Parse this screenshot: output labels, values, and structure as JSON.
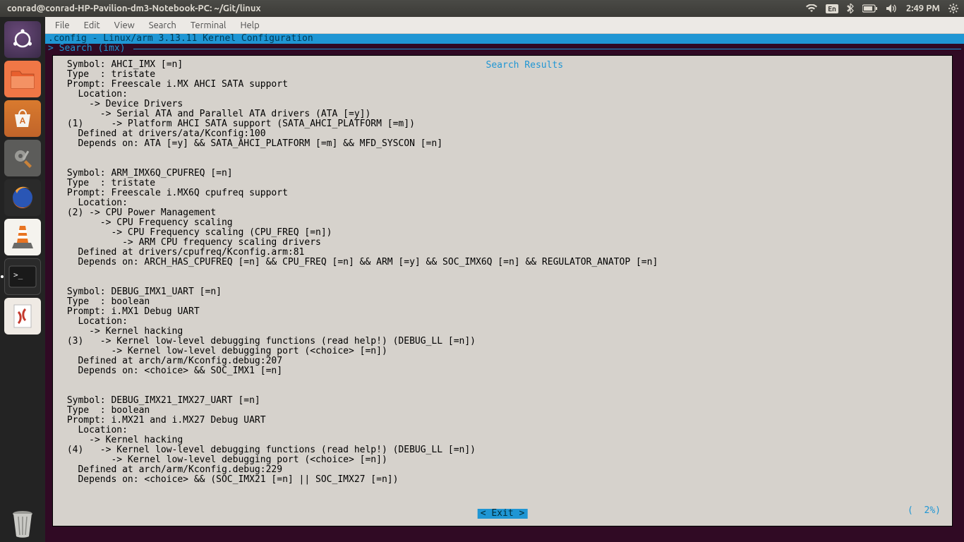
{
  "panel": {
    "title": "conrad@conrad-HP-Pavilion-dm3-Notebook-PC: ~/Git/linux",
    "lang": "En",
    "time": "2:49 PM"
  },
  "menubar": [
    "File",
    "Edit",
    "View",
    "Search",
    "Terminal",
    "Help"
  ],
  "terminal": {
    "config_line": ".config - Linux/arm 3.13.11 Kernel Configuration",
    "search_line": "> Search (imx) ",
    "results_title": "Search Results",
    "percent": "(  2%)",
    "exit": "< Exit >",
    "body": " Symbol: AHCI_IMX [=n]\n Type  : tristate\n Prompt: Freescale i.MX AHCI SATA support\n   Location:\n     -> Device Drivers\n       -> Serial ATA and Parallel ATA drivers (ATA [=y])\n (1)     -> Platform AHCI SATA support (SATA_AHCI_PLATFORM [=m])\n   Defined at drivers/ata/Kconfig:100\n   Depends on: ATA [=y] && SATA_AHCI_PLATFORM [=m] && MFD_SYSCON [=n]\n\n\n Symbol: ARM_IMX6Q_CPUFREQ [=n]\n Type  : tristate\n Prompt: Freescale i.MX6Q cpufreq support\n   Location:\n (2) -> CPU Power Management\n       -> CPU Frequency scaling\n         -> CPU Frequency scaling (CPU_FREQ [=n])\n           -> ARM CPU frequency scaling drivers\n   Defined at drivers/cpufreq/Kconfig.arm:81\n   Depends on: ARCH_HAS_CPUFREQ [=n] && CPU_FREQ [=n] && ARM [=y] && SOC_IMX6Q [=n] && REGULATOR_ANATOP [=n]\n\n\n Symbol: DEBUG_IMX1_UART [=n]\n Type  : boolean\n Prompt: i.MX1 Debug UART\n   Location:\n     -> Kernel hacking\n (3)   -> Kernel low-level debugging functions (read help!) (DEBUG_LL [=n])\n         -> Kernel low-level debugging port (<choice> [=n])\n   Defined at arch/arm/Kconfig.debug:207\n   Depends on: <choice> && SOC_IMX1 [=n]\n\n\n Symbol: DEBUG_IMX21_IMX27_UART [=n]\n Type  : boolean\n Prompt: i.MX21 and i.MX27 Debug UART\n   Location:\n     -> Kernel hacking\n (4)   -> Kernel low-level debugging functions (read help!) (DEBUG_LL [=n])\n         -> Kernel low-level debugging port (<choice> [=n])\n   Defined at arch/arm/Kconfig.debug:229\n   Depends on: <choice> && (SOC_IMX21 [=n] || SOC_IMX27 [=n])"
  }
}
